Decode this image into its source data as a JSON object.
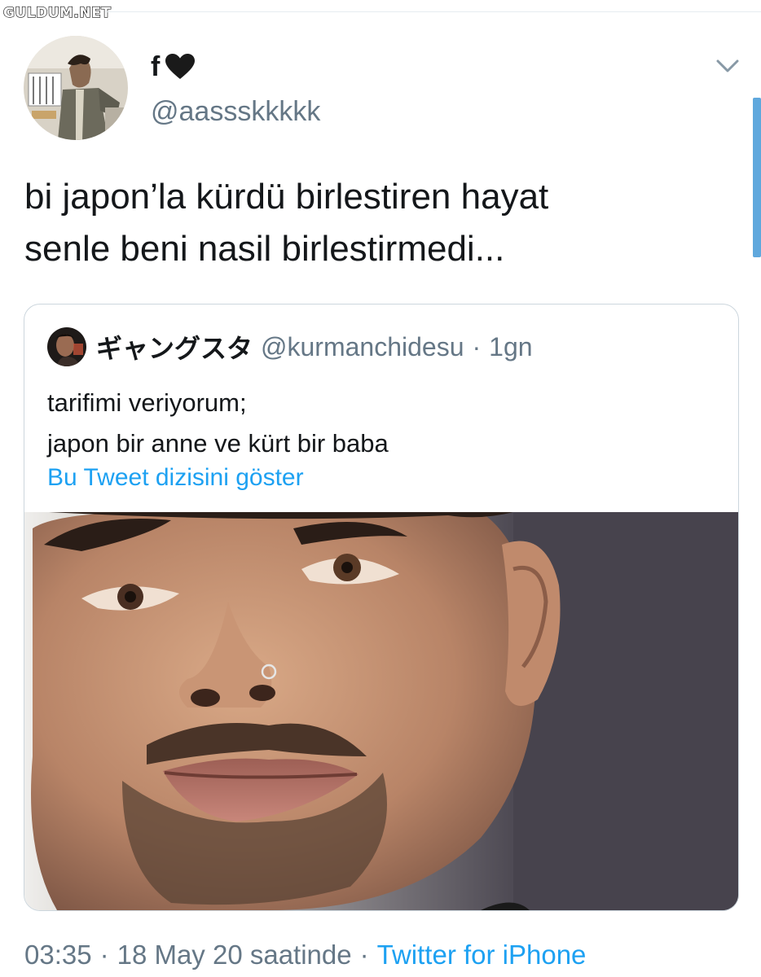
{
  "watermark": "GULDUM.NET",
  "tweet": {
    "display_name": "f",
    "name_emoji": "black-heart-icon",
    "handle": "@aassskkkkk",
    "text_lines": [
      "bi japon’la kürdü birlestiren hayat",
      "senle beni nasil birlestirmedi..."
    ]
  },
  "quoted_tweet": {
    "display_name": "ギャングスタ",
    "handle": "@kurmanchidesu",
    "separator": "·",
    "age": "1gn",
    "text_lines": [
      "tarifimi veriyorum;",
      "japon bir anne ve kürt bir baba"
    ],
    "show_thread_label": "Bu Tweet dizisini göster"
  },
  "meta": {
    "time": "03:35",
    "sep1": "·",
    "date": "18 May 20 saatinde",
    "sep2": "·",
    "source": "Twitter for iPhone"
  },
  "colors": {
    "text": "#14171a",
    "secondary": "#657786",
    "link": "#1da1f2",
    "border": "#ccd6dd"
  }
}
